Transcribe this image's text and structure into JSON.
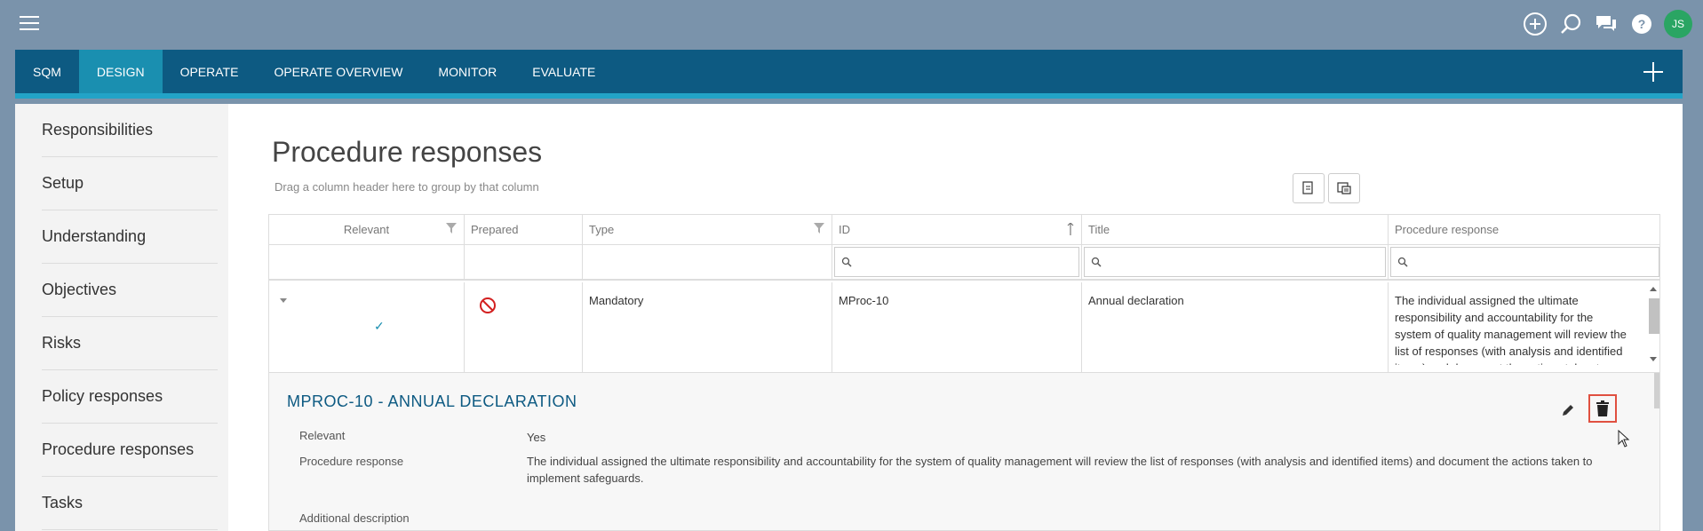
{
  "nav": {
    "tabs": [
      {
        "label": "SQM",
        "active": false
      },
      {
        "label": "DESIGN",
        "active": true
      },
      {
        "label": "OPERATE",
        "active": false
      },
      {
        "label": "OPERATE OVERVIEW",
        "active": false
      },
      {
        "label": "MONITOR",
        "active": false
      },
      {
        "label": "EVALUATE",
        "active": false
      }
    ]
  },
  "topbar": {
    "icons": [
      "add-circle-icon",
      "search-icon",
      "chat-icon",
      "help-icon"
    ],
    "avatar_initials": "JS"
  },
  "sidebar": {
    "items": [
      {
        "label": "Responsibilities"
      },
      {
        "label": "Setup"
      },
      {
        "label": "Understanding"
      },
      {
        "label": "Objectives"
      },
      {
        "label": "Risks"
      },
      {
        "label": "Policy responses"
      },
      {
        "label": "Procedure responses"
      },
      {
        "label": "Tasks"
      }
    ]
  },
  "main": {
    "title": "Procedure responses",
    "group_hint": "Drag a column header here to group by that column"
  },
  "grid": {
    "columns": [
      "Relevant",
      "Prepared",
      "Type",
      "ID",
      "Title",
      "Procedure response"
    ],
    "row": {
      "relevant": "✓",
      "type": "Mandatory",
      "id": "MProc-10",
      "title": "Annual declaration",
      "response": "The individual assigned the ultimate responsibility and accountability for the system of quality management will review the list of responses (with analysis and identified items) and document the actions taken to implement safeguards."
    }
  },
  "detail": {
    "title": "MPROC-10 - ANNUAL DECLARATION",
    "relevant_label": "Relevant",
    "relevant_value": "Yes",
    "response_label": "Procedure response",
    "response_value": "The individual assigned the ultimate responsibility and accountability for the system of quality management will review the list of responses (with analysis and identified items) and document the actions taken to implement safeguards.",
    "additional_label": "Additional description"
  },
  "colors": {
    "nav_bg": "#0d5a82",
    "nav_active": "#1a8fb0",
    "nav_underline": "#22a3c7",
    "accent_red": "#e05040",
    "avatar": "#2aa563"
  }
}
